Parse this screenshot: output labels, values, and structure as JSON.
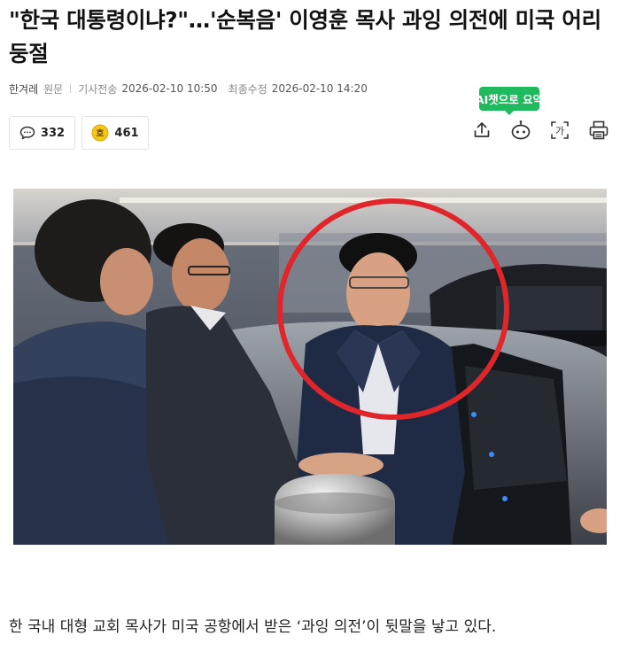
{
  "article": {
    "headline": "\"한국 대통령이냐?\"…'순복음' 이영훈 목사 과잉 의전에 미국 어리둥절",
    "source": "한겨레",
    "original_label": "원문",
    "sent_label": "기사전송",
    "sent_time": "2026-02-10 10:50",
    "modified_label": "최종수정",
    "modified_time": "2026-02-10 14:20",
    "body_first_line": "한 국내 대형 교회 목사가 미국 공항에서 받은 ‘과잉 의전’이 뒷말을 낳고 있다."
  },
  "stats": {
    "comments": "332",
    "reactions": "461",
    "reaction_badge": "호"
  },
  "ai_summary": {
    "label": "AI챗으로 요약"
  },
  "toolbar": {
    "icons": [
      "share-icon",
      "robot-icon",
      "translate-icon",
      "print-icon"
    ],
    "translate_glyph": "가"
  },
  "colors": {
    "accent_green": "#1fba5d",
    "highlight_circle": "#e0262b",
    "reaction_yellow": "#f5c518"
  }
}
